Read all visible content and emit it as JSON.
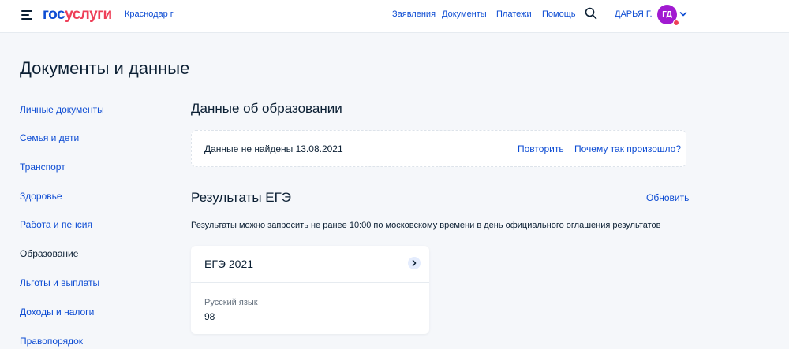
{
  "header": {
    "logo_part1": "гос",
    "logo_part2": "услуги",
    "city": "Краснодар г",
    "nav": [
      "Заявления",
      "Документы",
      "Платежи",
      "Помощь"
    ],
    "user_name": "ДАРЬЯ Г.",
    "avatar_initials": "ГД"
  },
  "page": {
    "title": "Документы и данные"
  },
  "sidebar": {
    "items": [
      {
        "label": "Личные документы"
      },
      {
        "label": "Семья и дети"
      },
      {
        "label": "Транспорт"
      },
      {
        "label": "Здоровье"
      },
      {
        "label": "Работа и пенсия"
      },
      {
        "label": "Образование"
      },
      {
        "label": "Льготы и выплаты"
      },
      {
        "label": "Доходы и налоги"
      },
      {
        "label": "Правопорядок"
      }
    ],
    "active": "Образование"
  },
  "education": {
    "title": "Данные об образовании",
    "notice": "Данные не найдены 13.08.2021",
    "retry": "Повторить",
    "why": "Почему так произошло?"
  },
  "ege": {
    "title": "Результаты ЕГЭ",
    "refresh": "Обновить",
    "hint": "Результаты можно запросить не ранее 10:00 по московскому времени в день официального оглашения результатов",
    "card": {
      "title": "ЕГЭ 2021",
      "subject": "Русский язык",
      "score": "98"
    }
  },
  "colors": {
    "accent": "#0d4cd3",
    "brand_red": "#ee3f58",
    "avatar": "#a11ad1",
    "background": "#f5f7fa"
  },
  "icons": [
    "menu-icon",
    "search-icon",
    "chevron-down-icon",
    "chevron-right-icon"
  ]
}
